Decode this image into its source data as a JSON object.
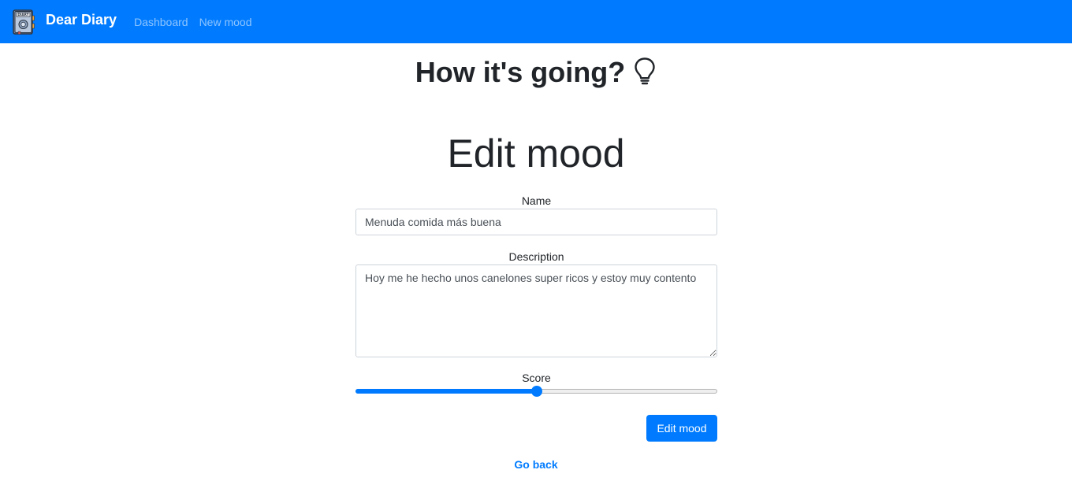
{
  "navbar": {
    "brand_logo_text": "DIARY",
    "brand_name": "Dear Diary",
    "links": [
      {
        "label": "Dashboard"
      },
      {
        "label": "New mood"
      }
    ]
  },
  "header": {
    "tagline": "How it's going?",
    "tagline_icon": "lightbulb-icon"
  },
  "page": {
    "title": "Edit mood"
  },
  "form": {
    "name_label": "Name",
    "name_value": "Menuda comida más buena",
    "description_label": "Description",
    "description_value": "Hoy me he hecho unos canelones super ricos y estoy muy contento",
    "score_label": "Score",
    "score_fraction": 0.5,
    "submit_label": "Edit mood"
  },
  "footer": {
    "go_back_label": "Go back"
  },
  "colors": {
    "primary": "#007bff",
    "text": "#212529",
    "nav_link_inactive": "rgba(255,255,255,0.55)"
  }
}
